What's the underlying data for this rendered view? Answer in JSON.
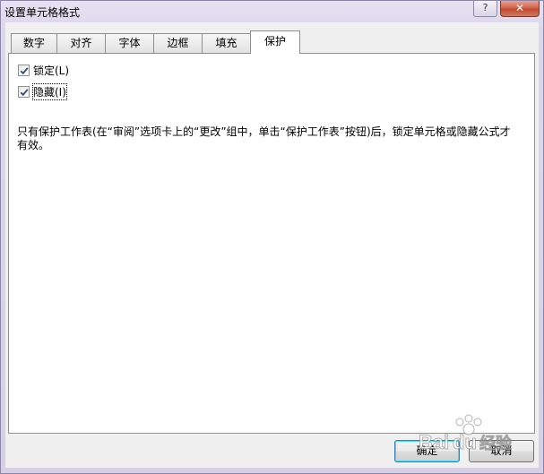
{
  "window": {
    "title": "设置单元格格式",
    "help_label": "?",
    "close_label": "✕"
  },
  "tabs": [
    {
      "label": "数字"
    },
    {
      "label": "对齐"
    },
    {
      "label": "字体"
    },
    {
      "label": "边框"
    },
    {
      "label": "填充"
    },
    {
      "label": "保护"
    }
  ],
  "active_tab": "保护",
  "protection": {
    "locked": {
      "label": "锁定(L)",
      "checked": true
    },
    "hidden": {
      "label": "隐藏(I)",
      "checked": true
    },
    "description": "只有保护工作表(在“审阅”选项卡上的“更改”组中，单击“保护工作表”按钮)后，锁定单元格或隐藏公式才有效。"
  },
  "buttons": {
    "ok_label": "确定",
    "cancel_label": "取消"
  },
  "watermark": {
    "text": "Baidu 经验"
  },
  "colors": {
    "title_bg": "#ddd7ec",
    "client_bg": "#f0f0f0",
    "panel_bg": "#ffffff",
    "close_button": "#c94f36",
    "default_button_border": "#3c7fb1"
  }
}
